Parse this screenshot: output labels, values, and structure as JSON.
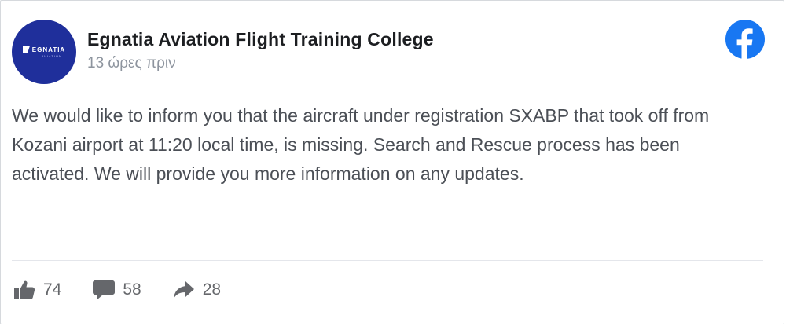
{
  "post": {
    "author": {
      "name": "Egnatia Aviation Flight Training College",
      "avatar_logo_text": "EGNATIA",
      "avatar_logo_subtext": "AVIATION"
    },
    "timestamp": "13 ώρες πριν",
    "text": "We would like to inform you that the aircraft under registration SXABP that took off from Kozani airport at 11:20 local time, is missing. Search and Rescue process has been activated. We will provide you more information on any updates.",
    "reactions": {
      "likes": "74",
      "comments": "58",
      "shares": "28"
    }
  },
  "colors": {
    "avatar_background": "#1f2f9b",
    "facebook_brand": "#1877f2",
    "action_icon": "#65676b"
  },
  "icons": {
    "platform": "facebook-icon",
    "like": "thumbs-up-icon",
    "comment": "speech-bubble-icon",
    "share": "share-arrow-icon"
  }
}
